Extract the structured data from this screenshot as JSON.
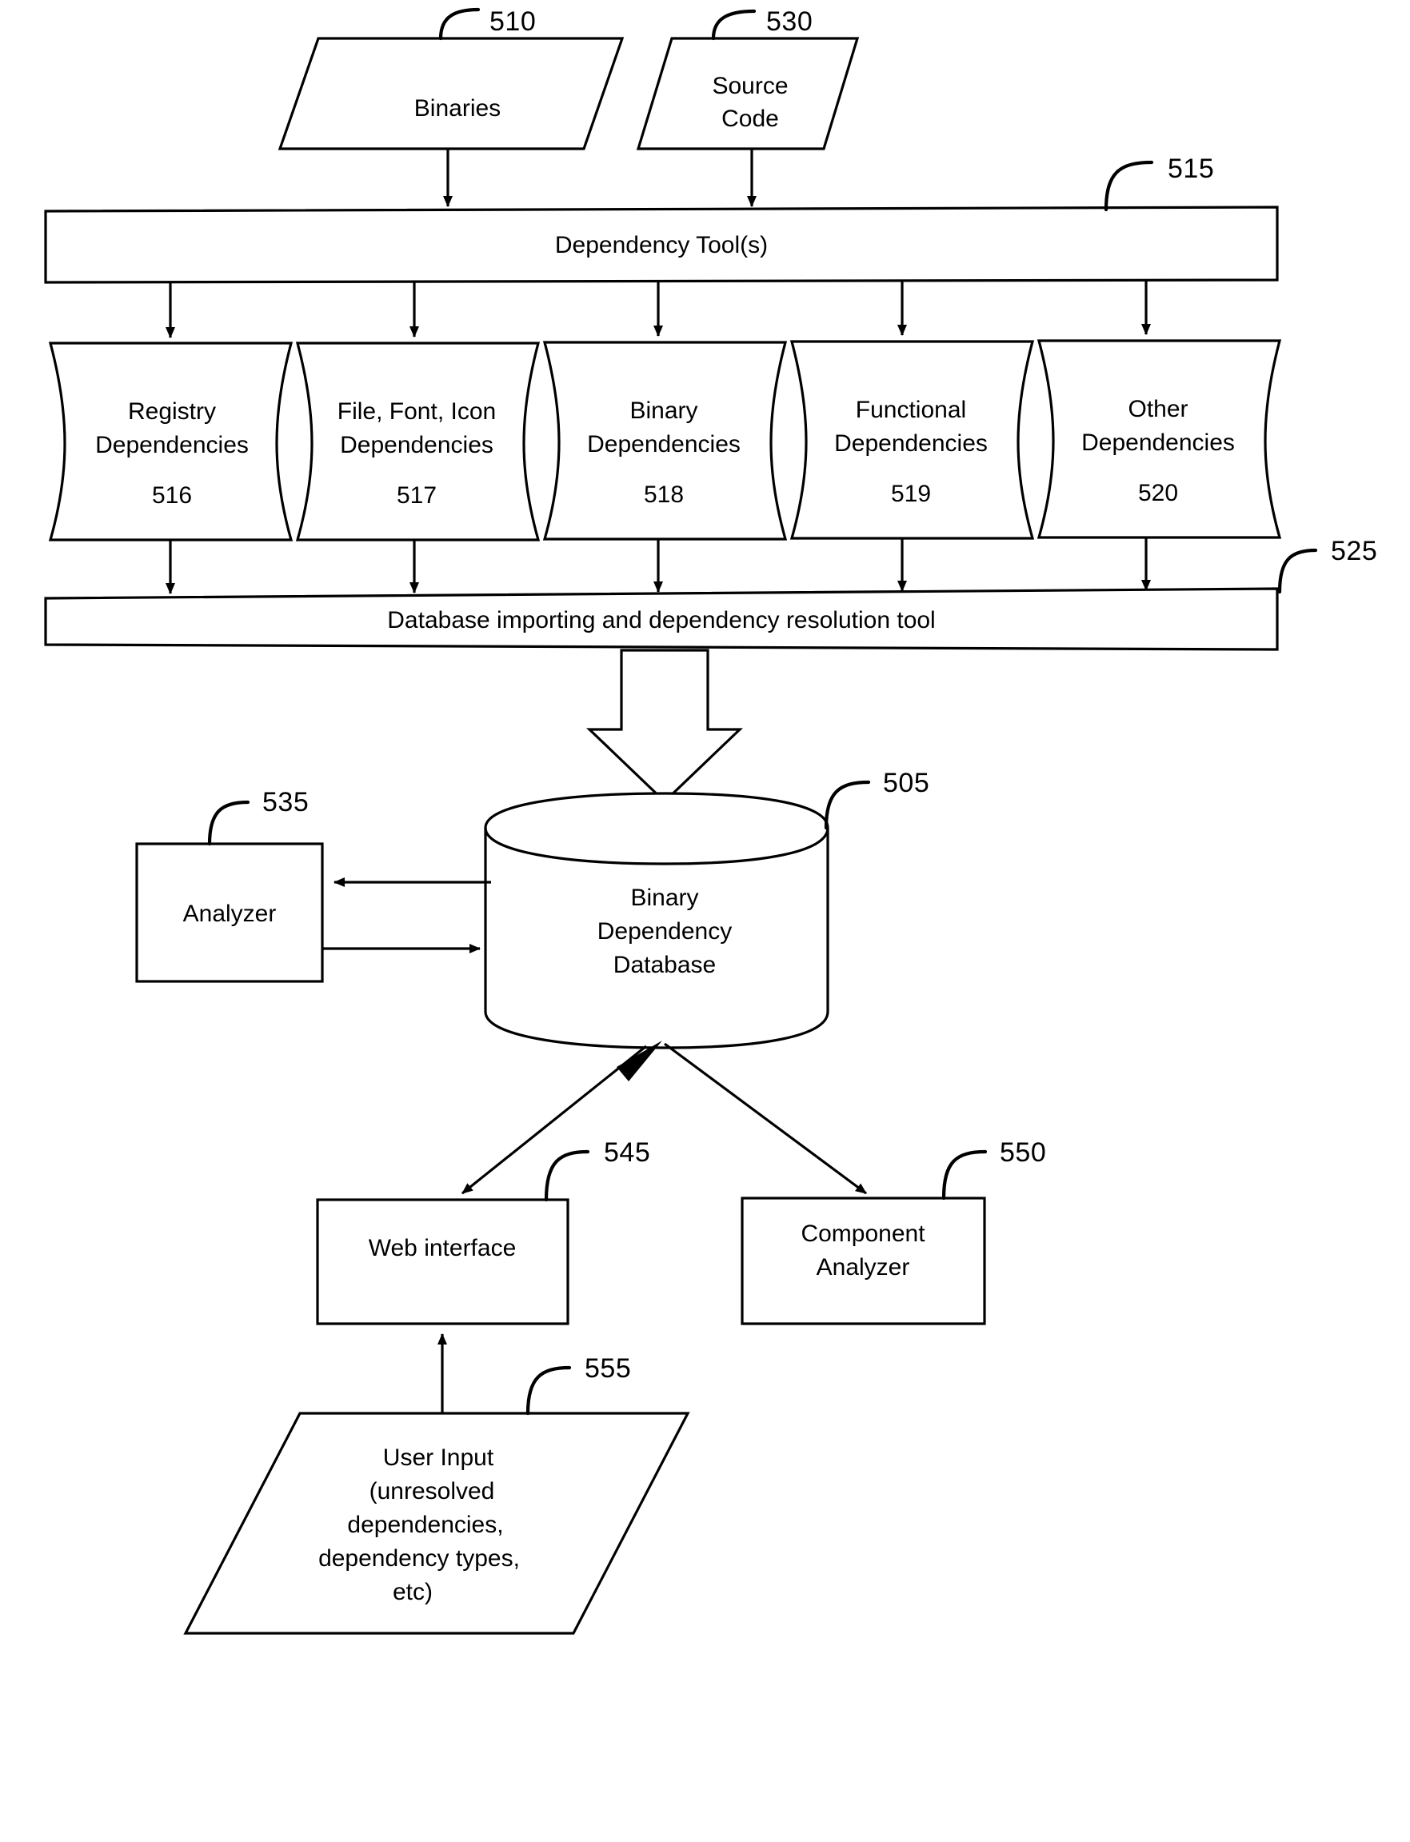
{
  "figure": {
    "kind": "patent-flow-diagram",
    "background": "#ffffff",
    "line_color": "#000000"
  },
  "nodes": {
    "binaries": {
      "label": "Binaries",
      "ref": "510",
      "shape": "parallelogram"
    },
    "source_code": {
      "label_line1": "Source",
      "label_line2": "Code",
      "ref": "530",
      "shape": "parallelogram"
    },
    "dependency_tools": {
      "label": "Dependency Tool(s)",
      "ref": "515",
      "shape": "bar"
    },
    "registry_dependencies": {
      "label_line1": "Registry",
      "label_line2": "Dependencies",
      "ref": "516",
      "shape": "stored-data"
    },
    "file_font_icon_dependencies": {
      "label_line1": "File, Font, Icon",
      "label_line2": "Dependencies",
      "ref": "517",
      "shape": "stored-data"
    },
    "binary_dependencies": {
      "label_line1": "Binary",
      "label_line2": "Dependencies",
      "ref": "518",
      "shape": "stored-data"
    },
    "functional_dependencies": {
      "label_line1": "Functional",
      "label_line2": "Dependencies",
      "ref": "519",
      "shape": "stored-data"
    },
    "other_dependencies": {
      "label_line1": "Other",
      "label_line2": "Dependencies",
      "ref": "520",
      "shape": "stored-data"
    },
    "import_tool": {
      "label": "Database importing and dependency resolution tool",
      "ref": "525",
      "shape": "bar"
    },
    "binary_dependency_database": {
      "label_line1": "Binary",
      "label_line2": "Dependency",
      "label_line3": "Database",
      "ref": "505",
      "shape": "cylinder"
    },
    "analyzer": {
      "label": "Analyzer",
      "ref": "535",
      "shape": "rectangle"
    },
    "web_interface": {
      "label": "Web interface",
      "ref": "545",
      "shape": "rectangle"
    },
    "component_analyzer": {
      "label_line1": "Component",
      "label_line2": "Analyzer",
      "ref": "550",
      "shape": "rectangle"
    },
    "user_input": {
      "label_line1": "User Input",
      "label_line2": "(unresolved",
      "label_line3": "dependencies,",
      "label_line4": "dependency types,",
      "label_line5": "etc)",
      "ref": "555",
      "shape": "parallelogram"
    }
  },
  "reference_numerals": [
    "510",
    "530",
    "515",
    "516",
    "517",
    "518",
    "519",
    "520",
    "525",
    "505",
    "535",
    "545",
    "550",
    "555"
  ]
}
